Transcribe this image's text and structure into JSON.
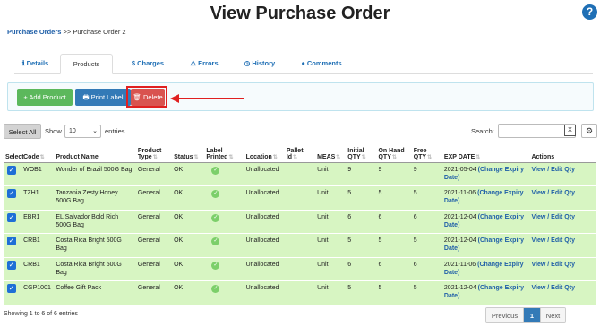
{
  "header": {
    "title": "View Purchase Order",
    "help_icon": "?"
  },
  "breadcrumb": {
    "root": "Purchase Orders",
    "separator": ">>",
    "current": "Purchase Order 2"
  },
  "tabs": [
    {
      "icon": "ℹ",
      "label": "Details"
    },
    {
      "icon": "",
      "label": "Products"
    },
    {
      "icon": "$",
      "label": "Charges"
    },
    {
      "icon": "⚠",
      "label": "Errors"
    },
    {
      "icon": "◷",
      "label": "History"
    },
    {
      "icon": "●",
      "label": "Comments"
    }
  ],
  "actions": {
    "add_label": "+ Add Product",
    "print_label": "Print Label",
    "delete_label": "Delete"
  },
  "controls": {
    "select_all": "Select All",
    "show": "Show",
    "entries_value": "10",
    "entries": "entries",
    "search_label": "Search:",
    "search_clear": "X",
    "settings_icon": "⚙"
  },
  "columns": [
    "Select",
    "Code",
    "Product Name",
    "Product Type",
    "Status",
    "Label Printed",
    "Location",
    "Pallet Id",
    "MEAS",
    "Initial QTY",
    "On Hand QTY",
    "Free QTY",
    "EXP DATE",
    "Actions"
  ],
  "rows": [
    {
      "code": "WOB1",
      "name": "Wonder of Brazil 500G Bag",
      "type": "General",
      "status": "OK",
      "location": "Unallocated",
      "pallet": "",
      "meas": "Unit",
      "initial": "9",
      "onhand": "9",
      "free": "9",
      "exp": "2021-05-04",
      "change": "(Change Expiry Date)",
      "actions": "View / Edit Qty"
    },
    {
      "code": "TZH1",
      "name": "Tanzania Zesty Honey 500G Bag",
      "type": "General",
      "status": "OK",
      "location": "Unallocated",
      "pallet": "",
      "meas": "Unit",
      "initial": "5",
      "onhand": "5",
      "free": "5",
      "exp": "2021-11-06",
      "change": "(Change Expiry Date)",
      "actions": "View / Edit Qty"
    },
    {
      "code": "EBR1",
      "name": "EL Salvador Bold Rich 500G Bag",
      "type": "General",
      "status": "OK",
      "location": "Unallocated",
      "pallet": "",
      "meas": "Unit",
      "initial": "6",
      "onhand": "6",
      "free": "6",
      "exp": "2021-12-04",
      "change": "(Change Expiry Date)",
      "actions": "View / Edit Qty"
    },
    {
      "code": "CRB1",
      "name": "Costa Rica Bright 500G Bag",
      "type": "General",
      "status": "OK",
      "location": "Unallocated",
      "pallet": "",
      "meas": "Unit",
      "initial": "5",
      "onhand": "5",
      "free": "5",
      "exp": "2021-12-04",
      "change": "(Change Expiry Date)",
      "actions": "View / Edit Qty"
    },
    {
      "code": "CRB1",
      "name": "Costa Rica Bright 500G Bag",
      "type": "General",
      "status": "OK",
      "location": "Unallocated",
      "pallet": "",
      "meas": "Unit",
      "initial": "6",
      "onhand": "6",
      "free": "6",
      "exp": "2021-11-06",
      "change": "(Change Expiry Date)",
      "actions": "View / Edit Qty"
    },
    {
      "code": "CGP1001",
      "name": "Coffee Gift Pack",
      "type": "General",
      "status": "OK",
      "location": "Unallocated",
      "pallet": "",
      "meas": "Unit",
      "initial": "5",
      "onhand": "5",
      "free": "5",
      "exp": "2021-12-04",
      "change": "(Change Expiry Date)",
      "actions": "View / Edit Qty"
    }
  ],
  "footer": {
    "info": "Showing 1 to 6 of 6 entries",
    "prev": "Previous",
    "page": "1",
    "next": "Next"
  },
  "colors": {
    "row_bg": "#d7f5c2",
    "link": "#1f5fa8",
    "unallocated": "#e53935",
    "highlight": "#e02020"
  }
}
